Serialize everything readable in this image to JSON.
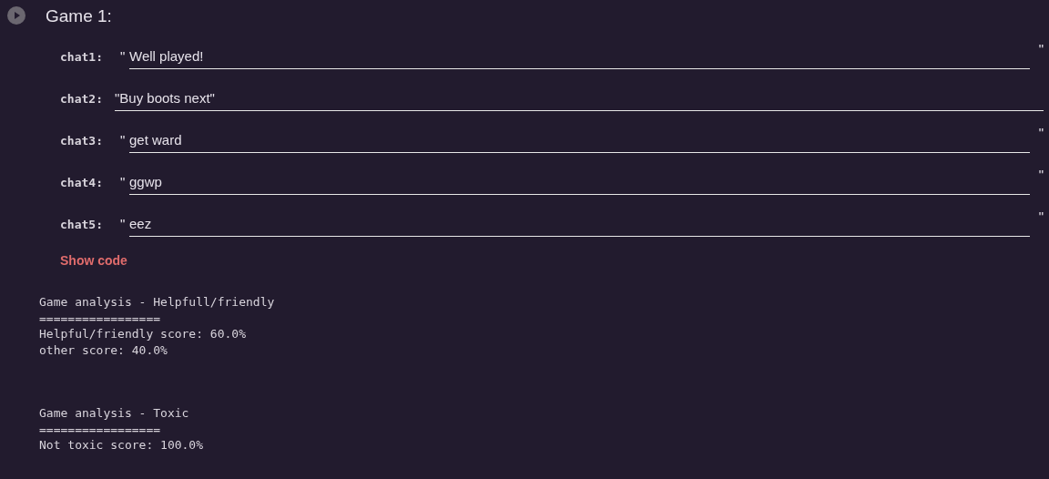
{
  "cell": {
    "title": "Game 1:",
    "fields": [
      {
        "label": "chat1:",
        "prefix": "\"",
        "value": "Well played!",
        "suffix": "\""
      },
      {
        "label": "chat2:",
        "value": "\"Buy boots next\""
      },
      {
        "label": "chat3:",
        "prefix": "\"",
        "value": "get ward",
        "suffix": "\""
      },
      {
        "label": "chat4:",
        "prefix": "\"",
        "value": "ggwp",
        "suffix": "\""
      },
      {
        "label": "chat5:",
        "prefix": "\"",
        "value": "eez",
        "suffix": "\""
      }
    ],
    "show_code": "Show code"
  },
  "output": [
    {
      "lines": [
        "Game analysis - Helpfull/friendly",
        "=================",
        "Helpful/friendly score: 60.0%",
        "other score: 40.0%"
      ]
    },
    {
      "lines": [
        "Game analysis - Toxic",
        "=================",
        "Not toxic score: 100.0%"
      ]
    }
  ]
}
